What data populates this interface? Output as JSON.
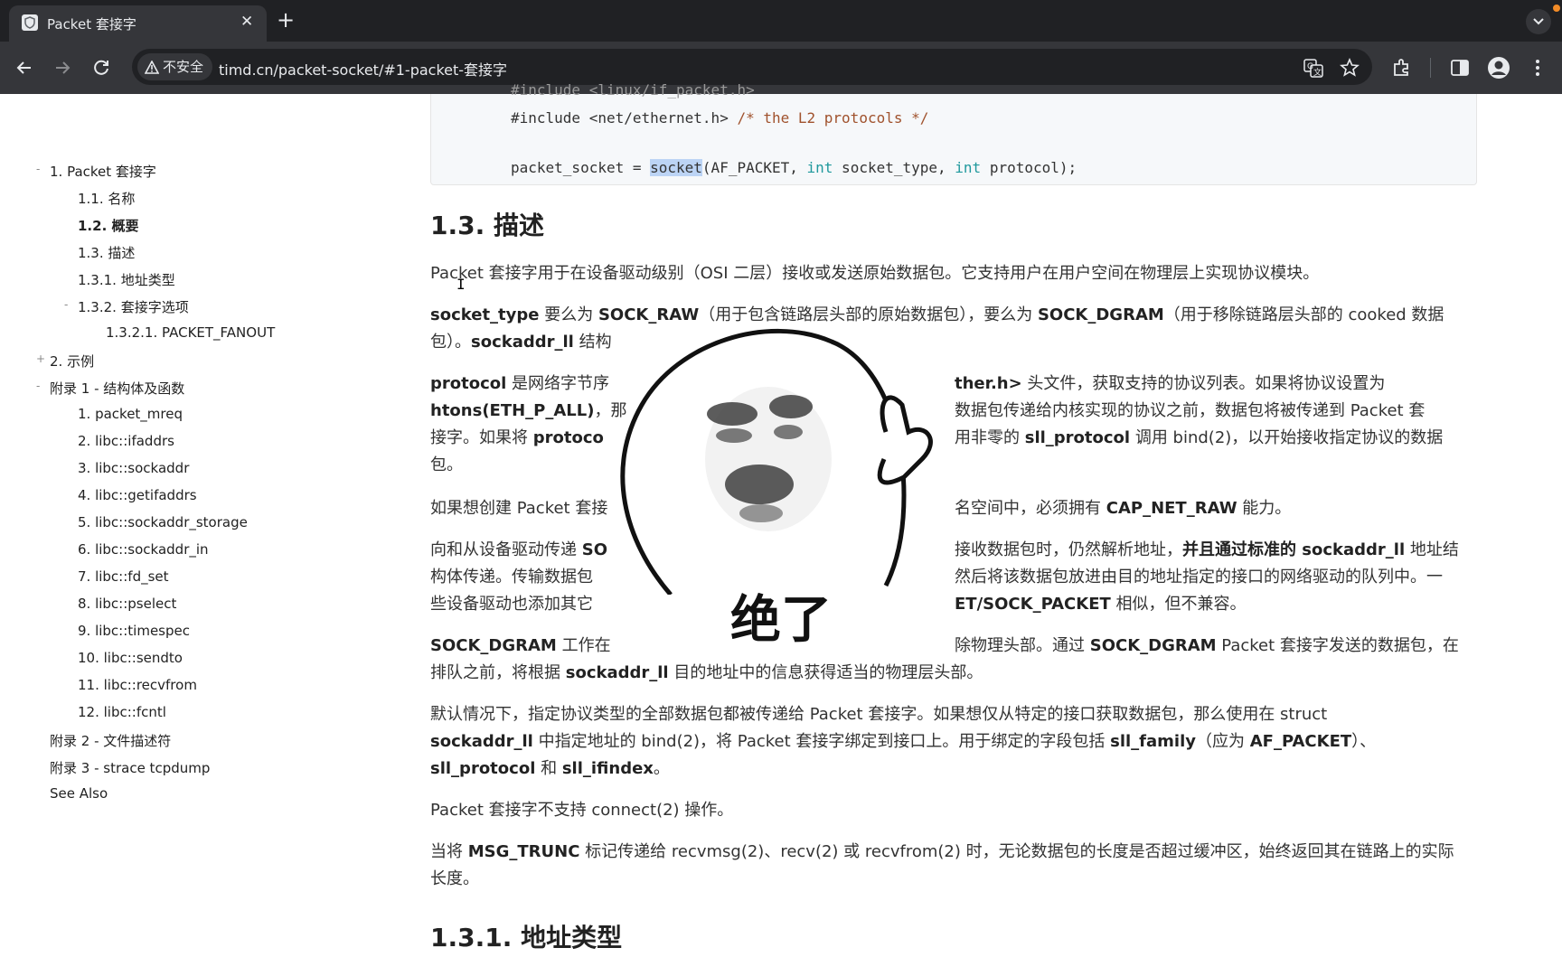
{
  "browser": {
    "tab_title": "Packet 套接字",
    "tab_close": "✕",
    "new_tab": "+",
    "security_label": "不安全",
    "url": "timd.cn/packet-socket/#1-packet-套接字"
  },
  "toc": {
    "items": [
      {
        "label": "1. Packet 套接字",
        "toggle": "-"
      },
      {
        "label": "1.1. 名称"
      },
      {
        "label": "1.2. 概要",
        "active": true
      },
      {
        "label": "1.3. 描述"
      },
      {
        "label": "1.3.1. 地址类型"
      },
      {
        "label": "1.3.2. 套接字选项",
        "toggle": "-"
      },
      {
        "label": "1.3.2.1. PACKET_FANOUT"
      },
      {
        "label": "2. 示例",
        "toggle": "+"
      },
      {
        "label": "附录 1 - 结构体及函数",
        "toggle": "-"
      },
      {
        "label": "1. packet_mreq"
      },
      {
        "label": "2. libc::ifaddrs"
      },
      {
        "label": "3. libc::sockaddr"
      },
      {
        "label": "4. libc::getifaddrs"
      },
      {
        "label": "5. libc::sockaddr_storage"
      },
      {
        "label": "6. libc::sockaddr_in"
      },
      {
        "label": "7. libc::fd_set"
      },
      {
        "label": "8. libc::pselect"
      },
      {
        "label": "9. libc::timespec"
      },
      {
        "label": "10. libc::sendto"
      },
      {
        "label": "11. libc::recvfrom"
      },
      {
        "label": "12. libc::fcntl"
      },
      {
        "label": "附录 2 - 文件描述符"
      },
      {
        "label": "附录 3 - strace tcpdump"
      },
      {
        "label": "See Also"
      }
    ]
  },
  "code": {
    "line_partial": "#include <linux/if_packet.h>",
    "include_prefix": "#include <net/ethernet.h> ",
    "include_comment": "/* the L2 protocols */",
    "call_a": "packet_socket = ",
    "call_fn": "socket",
    "call_b": "(AF_PACKET, ",
    "kw_int": "int",
    "call_c": " socket_type, ",
    "call_d": " protocol);"
  },
  "headings": {
    "h_desc": "1.3. 描述",
    "h_addr": "1.3.1. 地址类型"
  },
  "paragraphs": {
    "p1": "Packet 套接字用于在设备驱动级别（OSI 二层）接收或发送原始数据包。它支持用户在用户空间在物理层上实现协议模块。",
    "p2a": "socket_type",
    "p2b": " 要么为 ",
    "p2c": "SOCK_RAW",
    "p2d": "（用于包含链路层头部的原始数据包），要么为 ",
    "p2e": "SOCK_DGRAM",
    "p2f": "（用于移除链路层头部的 cooked 数据",
    "p2g": "包）。",
    "p2h": "sockaddr_ll",
    "p2i": " 结构",
    "p3a": "protocol",
    "p3b": " 是网络字节序",
    "p3c": "ther.h>",
    "p3d": " 头文件，获取支持的协议列表。如果将协议设置为",
    "p3e": "htons(ETH_P_ALL)",
    "p3f": "，那",
    "p3g": "数据包传递给内核实现的协议之前，数据包将被传递到 Packet 套",
    "p3h": "接字。如果将 ",
    "p3i": "protoco",
    "p3j": "用非零的 ",
    "p3k": "sll_protocol",
    "p3l": " 调用 bind(2)，以开始接收指定协议的数据",
    "p3m": "包。",
    "p4a": "如果想创建 Packet 套接",
    "p4b": "名空间中，必须拥有 ",
    "p4c": "CAP_NET_RAW",
    "p4d": " 能力。",
    "p5a": "向和从设备驱动传递 ",
    "p5b": "SO",
    "p5c": "接收数据包时，仍然解析地址，",
    "p5d": "并且通过标准的 ",
    "p5e": "sockaddr_ll",
    "p5f": " 地址结",
    "p5g": "构体传递。传输数据包",
    "p5h": "然后将该数据包放进由目的地址指定的接口的网络驱动的队列中。一",
    "p5i": "些设备驱动也添加其它",
    "p5j": "ET/SOCK_PACKET",
    "p5k": " 相似，但不兼容。",
    "p6a": "SOCK_DGRAM",
    "p6b": " 工作在",
    "p6c": "除物理头部。通过 ",
    "p6d": "SOCK_DGRAM",
    "p6e": " Packet 套接字发送的数据包，在",
    "p6f": "排队之前，将根据 ",
    "p6g": "sockaddr_ll",
    "p6h": " 目的地址中的信息获得适当的物理层头部。",
    "p7a": "默认情况下，指定协议类型的全部数据包都被传递给 Packet 套接字。如果想仅从特定的接口获取数据包，那么使用在 struct",
    "p7b": "sockaddr_ll",
    "p7c": " 中指定地址的 bind(2)，将 Packet 套接字绑定到接口上。用于绑定的字段包括 ",
    "p7d": "sll_family",
    "p7e": "（应为 ",
    "p7f": "AF_PACKET",
    "p7g": "）、",
    "p7h": "sll_protocol",
    "p7i": " 和 ",
    "p7j": "sll_ifindex",
    "p7k": "。",
    "p8": "Packet 套接字不支持 connect(2) 操作。",
    "p9a": "当将 ",
    "p9b": "MSG_TRUNC",
    "p9c": " 标记传递给 recvmsg(2)、recv(2) 或 recvfrom(2) 时，无论数据包的长度是否超过缓冲区，始终返回其在链路上的实际",
    "p9d": "长度。"
  },
  "overlay": {
    "caption": "绝了"
  }
}
